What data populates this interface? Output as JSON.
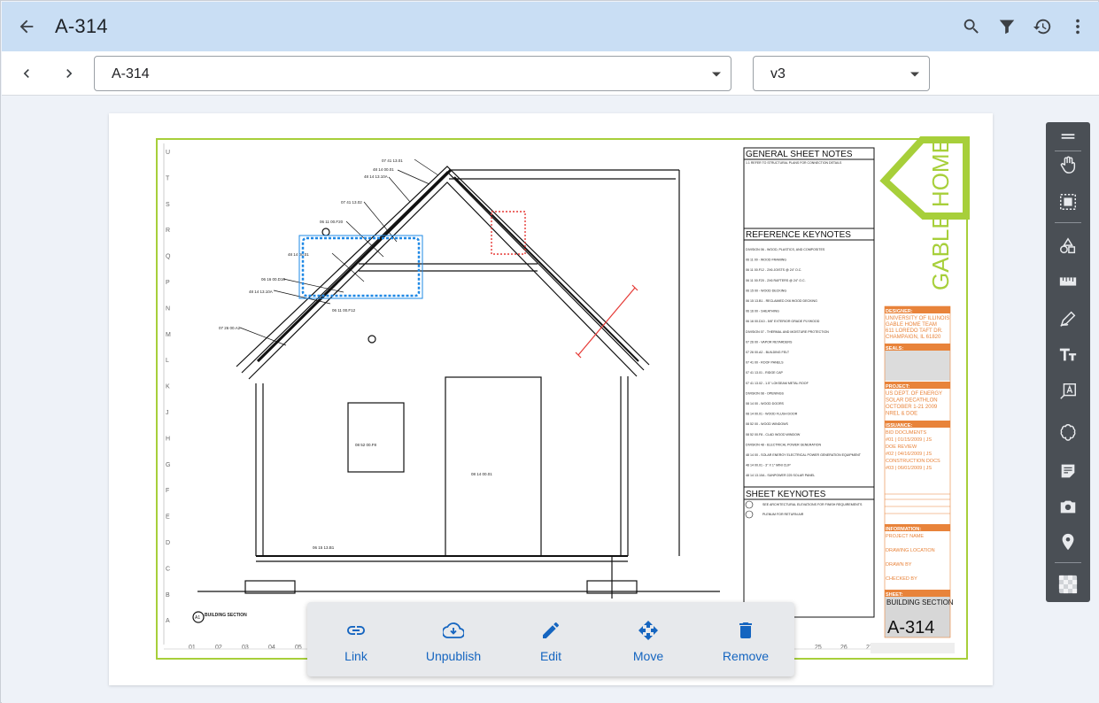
{
  "header": {
    "title": "A-314"
  },
  "toolbar": {
    "sheet_value": "A-314",
    "version_value": "v3"
  },
  "sheet": {
    "general_notes_heading": "GENERAL SHEET NOTES",
    "reference_keynotes_heading": "REFERENCE KEYNOTES",
    "sheet_keynotes_heading": "SHEET KEYNOTES",
    "logo_text": "GABLE HOME",
    "designer_label": "DESIGNER:",
    "designer_lines": [
      "UNIVERSITY OF ILLINOIS",
      "GABLE HOME TEAM",
      "611 LOREDO TAFT DR.",
      "CHAMPAIGN, IL 61820"
    ],
    "seals_label": "SEALS:",
    "project_label": "PROJECT:",
    "project_lines": [
      "US DEPT. OF ENERGY",
      "SOLAR DECATHLON",
      "OCTOBER 1-21 2009",
      "NREL & DOE"
    ],
    "issuance_label": "ISSUANCE:",
    "issuance_rows": [
      "BID DOCUMENTS",
      "#01 | 01/15/2009 | JS",
      "DOE REVIEW",
      "#02 | 04/16/2009 | JS",
      "CONSTRUCTION DOCS",
      "#03 | 06/01/2009 | JS"
    ],
    "information_label": "INFORMATION:",
    "info_rows": [
      "PROJECT NAME",
      "DRAWING LOCATION",
      "DRAWN BY",
      "CHECKED BY"
    ],
    "sheet_label": "SHEET:",
    "sheet_name": "BUILDING SECTION",
    "sheet_number": "A-314",
    "section_title": "BUILDING SECTION",
    "section_marker": "A1",
    "axis_left": [
      "U",
      "T",
      "S",
      "R",
      "Q",
      "P",
      "N",
      "M",
      "L",
      "K",
      "J",
      "H",
      "G",
      "F",
      "E",
      "D",
      "C",
      "B",
      "A"
    ],
    "axis_bottom": [
      "01",
      "02",
      "03",
      "04",
      "05",
      "25",
      "26",
      "27"
    ],
    "callouts": {
      "c1": "07 41 13.01",
      "c2": "48 14 00.01",
      "c3": "48 14 13.10A",
      "c4": "07 41 13.02",
      "c5": "06 11 00.F20",
      "c6": "48 14 00.01",
      "c7": "06 16 00.D10",
      "c8": "48 14 13.10A",
      "c9": "06 11 00.F12",
      "c10": "07 26 00.A2",
      "c11": "08 52 00.F8",
      "c12": "08 14 00.01",
      "c13": "06 15 13.B1"
    },
    "keynote_lines": [
      "DIVISION 06 - WOOD, PLASTICS, AND COMPOSITES",
      "06 11 00 - WOOD FRAMING",
      "06 11 00.F12   -   2X6 JOISTS @ 24\" O.C.",
      "06 11 00.F20   -   2X6 RAFTERS @ 24\" O.C.",
      "06 15 00 - WOOD DECKING",
      "06 15 13.B1   -   RECLAIMED 2X6 WOOD DECKING",
      "06 16 00 - SHEATHING",
      "06 16 00.D10   -   5/8\" EXTERIOR GRADE PLYWOOD",
      "DIVISION 07 - THERMAL AND MOISTURE PROTECTION",
      "07 26 00 - VAPOR RETARDERS",
      "07 26 00.A2   -   BUILDING FELT",
      "07 41 00 - ROOF PANELS",
      "07 41 13.01   -   RIDGE CAP",
      "07 41 13.02   -   1.5\" LOKSEAM METAL ROOF",
      "DIVISION 08 - OPENINGS",
      "08 14 00 - WOOD DOORS",
      "08 14 00.01   -   WOOD FLUSH DOOR",
      "08 52 00 - WOOD WINDOWS",
      "08 52 00.F8   -   CLAD WOOD WINDOW",
      "DIVISION 48 - ELECTRICAL POWER GENERATION",
      "48 14 00 - SOLAR ENERGY ELECTRICAL POWER GENERATION EQUIPMENT",
      "48 14 00.01   -   3\" X 1\" MINI CLIP",
      "48 14 13.10A   -   SUNPOWER 225 SOLAR PANEL"
    ],
    "general_note_line": "1.1   REFER TO STRUCTURAL PLANS FOR CONNECTION DETAILS",
    "sheet_keynote_lines": [
      "SEE ARCHITECTURAL ELEVATIONS FOR FINISH REQUIREMENTS",
      "PLENUM FOR RETURN AIR"
    ]
  },
  "actions": [
    {
      "label": "Link",
      "icon": "link-icon"
    },
    {
      "label": "Unpublish",
      "icon": "cloud-download-icon"
    },
    {
      "label": "Edit",
      "icon": "pencil-icon"
    },
    {
      "label": "Move",
      "icon": "move-icon"
    },
    {
      "label": "Remove",
      "icon": "trash-icon"
    }
  ],
  "tools": [
    "drag-handle-icon",
    "hand-icon",
    "select-area-icon",
    "shapes-icon",
    "ruler-icon",
    "markup-pen-icon",
    "text-size-icon",
    "text-box-icon",
    "cloud-icon",
    "note-icon",
    "camera-icon",
    "location-pin-icon",
    "transparency-icon"
  ],
  "colors": {
    "appbar": "#c9def4",
    "accent": "#1565c0",
    "tool_panel": "#4a4f55",
    "selection": "#1e88e5",
    "markup_red": "#e53935",
    "title_block_orange": "#e8833a",
    "logo_green": "#a7cf3a"
  }
}
